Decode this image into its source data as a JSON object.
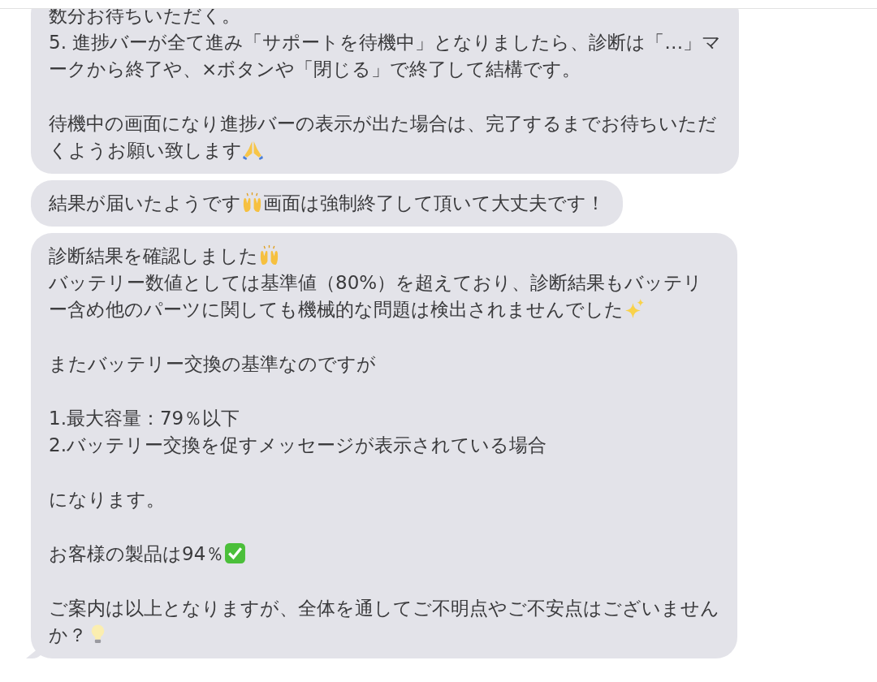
{
  "messages": [
    {
      "blocks": [
        [
          [
            {
              "kind": "text",
              "text": "数分お待ちいただく。"
            }
          ],
          [
            {
              "kind": "text",
              "text": "5. 進捗バーが全て進み「サポートを待機中」となりましたら、診断は「…」マ"
            }
          ],
          [
            {
              "kind": "text",
              "text": "ークから終了や、×ボタンや「閉じる」で終了して結構です。"
            }
          ]
        ],
        [
          [
            {
              "kind": "text",
              "text": "待機中の画面になり進捗バーの表示が出た場合は、完了するまでお待ちいただ"
            }
          ],
          [
            {
              "kind": "text",
              "text": "くようお願い致します"
            },
            {
              "kind": "pray"
            }
          ]
        ]
      ]
    },
    {
      "blocks": [
        [
          [
            {
              "kind": "text",
              "text": "結果が届いたようです"
            },
            {
              "kind": "raise"
            },
            {
              "kind": "text",
              "text": "画面は強制終了して頂いて大丈夫です！"
            }
          ]
        ]
      ]
    },
    {
      "blocks": [
        [
          [
            {
              "kind": "text",
              "text": "診断結果を確認しました"
            },
            {
              "kind": "raise"
            }
          ],
          [
            {
              "kind": "text",
              "text": "バッテリー数値としては基準値（80%）を超えており、診断結果もバッテリ"
            }
          ],
          [
            {
              "kind": "text",
              "text": "ー含め他のパーツに関しても機械的な問題は検出されませんでした"
            },
            {
              "kind": "sparkles"
            }
          ]
        ],
        [
          [
            {
              "kind": "text",
              "text": "またバッテリー交換の基準なのですが"
            }
          ]
        ],
        [
          [
            {
              "kind": "text",
              "text": "1.最大容量：79％以下"
            }
          ],
          [
            {
              "kind": "text",
              "text": "2.バッテリー交換を促すメッセージが表示されている場合"
            }
          ]
        ],
        [
          [
            {
              "kind": "text",
              "text": "になります。"
            }
          ]
        ],
        [
          [
            {
              "kind": "text",
              "text": "お客様の製品は94％"
            },
            {
              "kind": "check"
            }
          ]
        ],
        [
          [
            {
              "kind": "text",
              "text": "ご案内は以上となりますが、全体を通してご不明点やご不安点はございません"
            }
          ],
          [
            {
              "kind": "text",
              "text": "か？"
            },
            {
              "kind": "bulb"
            }
          ]
        ]
      ]
    }
  ]
}
